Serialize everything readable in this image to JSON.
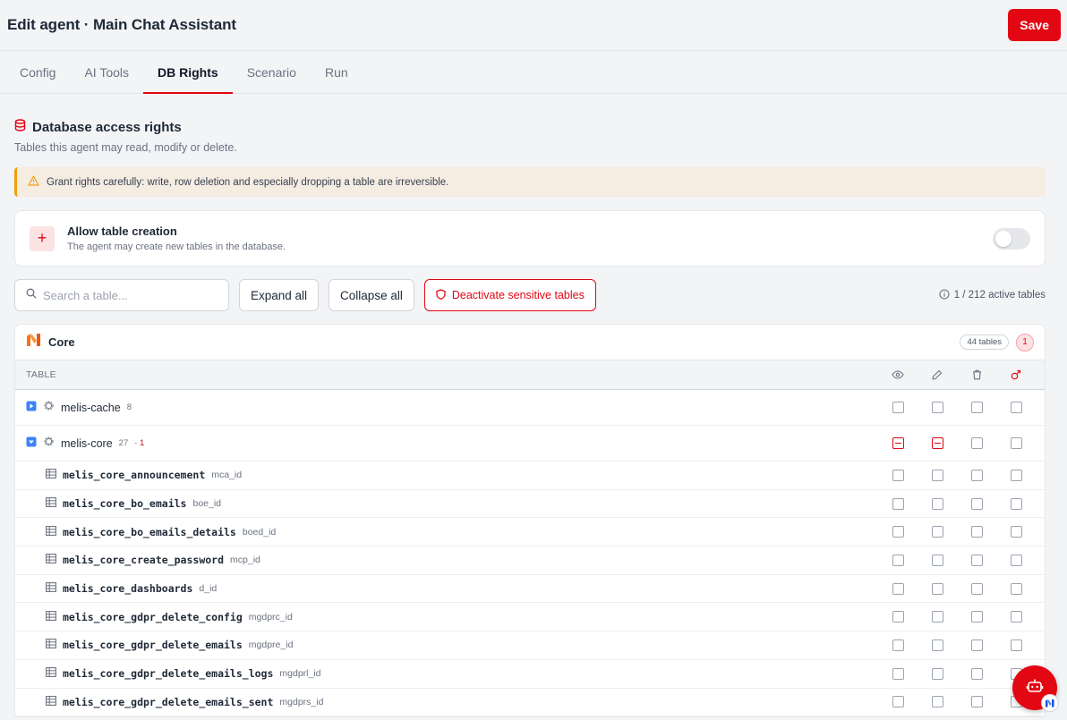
{
  "header": {
    "title": "Edit agent · Main Chat Assistant",
    "save_label": "Save"
  },
  "tabs": [
    {
      "label": "Config",
      "active": false
    },
    {
      "label": "AI Tools",
      "active": false
    },
    {
      "label": "DB Rights",
      "active": true
    },
    {
      "label": "Scenario",
      "active": false
    },
    {
      "label": "Run",
      "active": false
    }
  ],
  "section": {
    "title": "Database access rights",
    "subtitle": "Tables this agent may read, modify or delete."
  },
  "warning": {
    "text": "Grant rights carefully: write, row deletion and especially dropping a table are irreversible."
  },
  "table_creation": {
    "title": "Allow table creation",
    "subtitle": "The agent may create new tables in the database.",
    "enabled": false
  },
  "toolbar": {
    "search_placeholder": "Search a table...",
    "expand_label": "Expand all",
    "collapse_label": "Collapse all",
    "deactivate_label": "Deactivate sensitive tables",
    "active_count": "1 / 212 active tables"
  },
  "group": {
    "name": "Core",
    "tables_count": "44 tables",
    "badge": "1",
    "column_label": "TABLE"
  },
  "databases": [
    {
      "name": "melis-cache",
      "count": "8",
      "flag": "",
      "expanded": false,
      "perms": [
        "none",
        "none",
        "none",
        "none"
      ]
    },
    {
      "name": "melis-core",
      "count": "27",
      "flag": "· 1",
      "expanded": true,
      "perms": [
        "partial",
        "partial",
        "none",
        "none"
      ]
    }
  ],
  "tables": [
    {
      "name": "melis_core_announcement",
      "pk": "mca_id"
    },
    {
      "name": "melis_core_bo_emails",
      "pk": "boe_id"
    },
    {
      "name": "melis_core_bo_emails_details",
      "pk": "boed_id"
    },
    {
      "name": "melis_core_create_password",
      "pk": "mcp_id"
    },
    {
      "name": "melis_core_dashboards",
      "pk": "d_id"
    },
    {
      "name": "melis_core_gdpr_delete_config",
      "pk": "mgdprc_id"
    },
    {
      "name": "melis_core_gdpr_delete_emails",
      "pk": "mgdpre_id"
    },
    {
      "name": "melis_core_gdpr_delete_emails_logs",
      "pk": "mgdprl_id"
    },
    {
      "name": "melis_core_gdpr_delete_emails_sent",
      "pk": "mgdprs_id"
    }
  ],
  "colors": {
    "accent": "#e30613",
    "warning_border": "#f59e0b",
    "warning_bg": "#f5ece2"
  },
  "icons": {
    "section": "database-icon",
    "warning": "alert-triangle-icon",
    "search": "search-icon",
    "shield": "shield-icon",
    "info": "info-icon",
    "group": "melis-logo-icon",
    "read": "eye-icon",
    "write": "pencil-icon",
    "delete": "trash-icon",
    "drop": "drop-icon",
    "db": "gear-icon",
    "table": "table-icon",
    "bot": "robot-icon"
  }
}
